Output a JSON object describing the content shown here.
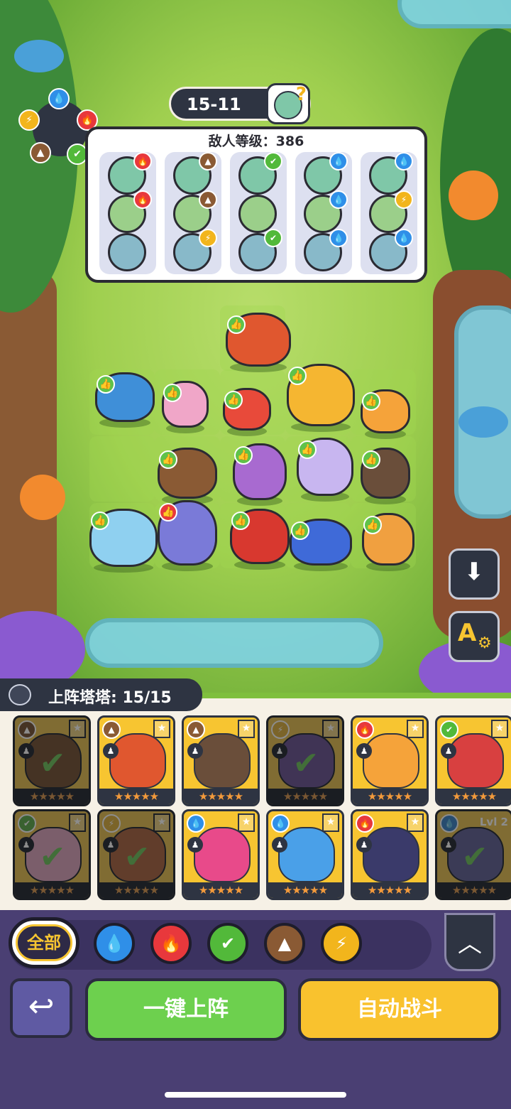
{
  "stage": {
    "level": "15-11",
    "help_icon": "zombie-question-icon"
  },
  "enemy_panel": {
    "title": "敌人等级：386",
    "columns": [
      {
        "faces": [
          "fire",
          "fire",
          "none"
        ]
      },
      {
        "faces": [
          "earth",
          "earth",
          "thunder"
        ]
      },
      {
        "faces": [
          "leaf",
          "none",
          "leaf"
        ]
      },
      {
        "faces": [
          "water",
          "water",
          "water"
        ]
      },
      {
        "faces": [
          "water",
          "thunder",
          "water"
        ]
      }
    ]
  },
  "element_wheel": {
    "icons": [
      "water-icon",
      "fire-icon",
      "leaf-icon",
      "earth-icon",
      "thunder-icon"
    ]
  },
  "side_buttons": {
    "download_icon": "download-icon",
    "auto_settings_icon": "auto-settings-icon",
    "auto_label": "A"
  },
  "roster": {
    "label": "上阵塔塔: 15/15",
    "cards": [
      {
        "element": "earth",
        "selected": true,
        "stars": "★★★★★"
      },
      {
        "element": "earth",
        "selected": false,
        "stars": "★★★★★"
      },
      {
        "element": "earth",
        "selected": false,
        "stars": "★★★★★"
      },
      {
        "element": "thunder",
        "selected": true,
        "stars": "★★★★★"
      },
      {
        "element": "fire",
        "selected": false,
        "stars": "★★★★★"
      },
      {
        "element": "leaf",
        "selected": false,
        "stars": "★★★★★"
      },
      {
        "element": "leaf",
        "selected": true,
        "stars": "★★★★★"
      },
      {
        "element": "thunder",
        "selected": true,
        "stars": "★★★★★"
      },
      {
        "element": "water",
        "selected": false,
        "stars": "★★★★★"
      },
      {
        "element": "water",
        "selected": false,
        "stars": "★★★★★"
      },
      {
        "element": "fire",
        "selected": false,
        "stars": "★★★★★"
      },
      {
        "element": "water",
        "selected": true,
        "stars": "★★★★★",
        "level": "Lvl 2"
      }
    ]
  },
  "filters": {
    "all_label": "全部",
    "elements": [
      "water",
      "fire",
      "leaf",
      "earth",
      "thunder"
    ]
  },
  "colors": {
    "water": "#2f8fe8",
    "fire": "#e8383c",
    "leaf": "#52b93a",
    "earth": "#8a5a34",
    "thunder": "#f2b51c",
    "none": "#7fc7a8"
  },
  "actions": {
    "back_icon": "return-arrow-icon",
    "collapse_icon": "chevron-up-icon",
    "deploy_label": "一键上阵",
    "auto_battle_label": "自动战斗"
  }
}
